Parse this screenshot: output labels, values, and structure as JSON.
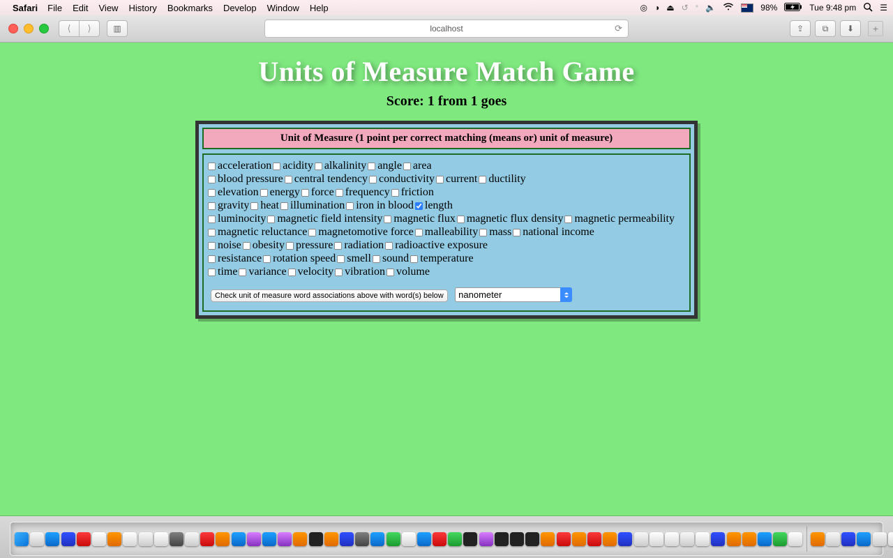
{
  "menubar": {
    "app": "Safari",
    "items": [
      "File",
      "Edit",
      "View",
      "History",
      "Bookmarks",
      "Develop",
      "Window",
      "Help"
    ],
    "battery": "98%",
    "clock": "Tue 9:48 pm"
  },
  "browser": {
    "url": "localhost"
  },
  "page": {
    "title": "Units of Measure Match Game",
    "score_label": "Score: 1 from 1 goes",
    "instruction": "Unit of Measure (1 point per correct matching (means or) unit of measure)",
    "checkboxes": [
      {
        "label": "acceleration",
        "checked": false
      },
      {
        "label": "acidity",
        "checked": false
      },
      {
        "label": "alkalinity",
        "checked": false
      },
      {
        "label": "angle",
        "checked": false
      },
      {
        "label": "area",
        "checked": false,
        "break": true
      },
      {
        "label": "blood pressure",
        "checked": false
      },
      {
        "label": "central tendency",
        "checked": false
      },
      {
        "label": "conductivity",
        "checked": false
      },
      {
        "label": "current",
        "checked": false
      },
      {
        "label": "ductility",
        "checked": false,
        "break": true
      },
      {
        "label": "elevation",
        "checked": false
      },
      {
        "label": "energy",
        "checked": false
      },
      {
        "label": "force",
        "checked": false
      },
      {
        "label": "frequency",
        "checked": false
      },
      {
        "label": "friction",
        "checked": false,
        "break": true
      },
      {
        "label": "gravity",
        "checked": false
      },
      {
        "label": "heat",
        "checked": false
      },
      {
        "label": "illumination",
        "checked": false
      },
      {
        "label": "iron in blood",
        "checked": false
      },
      {
        "label": "length",
        "checked": true,
        "break": true
      },
      {
        "label": "luminocity",
        "checked": false
      },
      {
        "label": "magnetic field intensity",
        "checked": false
      },
      {
        "label": "magnetic flux",
        "checked": false
      },
      {
        "label": "magnetic flux density",
        "checked": false
      },
      {
        "label": "magnetic permeability",
        "checked": false,
        "break": true
      },
      {
        "label": "magnetic reluctance",
        "checked": false
      },
      {
        "label": "magnetomotive force",
        "checked": false
      },
      {
        "label": "malleability",
        "checked": false
      },
      {
        "label": "mass",
        "checked": false
      },
      {
        "label": "national income",
        "checked": false,
        "break": true
      },
      {
        "label": "noise",
        "checked": false
      },
      {
        "label": "obesity",
        "checked": false
      },
      {
        "label": "pressure",
        "checked": false
      },
      {
        "label": "radiation",
        "checked": false
      },
      {
        "label": "radioactive exposure",
        "checked": false,
        "break": true
      },
      {
        "label": "resistance",
        "checked": false
      },
      {
        "label": "rotation speed",
        "checked": false
      },
      {
        "label": "smell",
        "checked": false
      },
      {
        "label": "sound",
        "checked": false
      },
      {
        "label": "temperature",
        "checked": false,
        "break": true
      },
      {
        "label": "time",
        "checked": false
      },
      {
        "label": "variance",
        "checked": false
      },
      {
        "label": "velocity",
        "checked": false
      },
      {
        "label": "vibration",
        "checked": false
      },
      {
        "label": "volume",
        "checked": false
      }
    ],
    "check_button": "Check unit of measure word associations above with word(s) below",
    "select_value": "nanometer"
  },
  "dock": {
    "icons": [
      "finder",
      "c1",
      "c2",
      "c3",
      "c4",
      "c9",
      "c5",
      "c9",
      "c1",
      "c9",
      "c6",
      "c1",
      "c4",
      "c5",
      "c2",
      "c7",
      "c2",
      "c7",
      "c5",
      "c10",
      "c5",
      "c3",
      "c6",
      "c2",
      "c8",
      "c9",
      "c2",
      "c4",
      "c8",
      "c10",
      "c7",
      "c10",
      "c10",
      "c10",
      "c5",
      "c4",
      "c5",
      "c4",
      "c5",
      "c3",
      "c1",
      "c9",
      "c9",
      "c1",
      "c9",
      "c3",
      "c5",
      "c5",
      "c2",
      "c8",
      "c9"
    ],
    "right_icons": [
      "c5",
      "c1",
      "c3",
      "c2",
      "c1",
      "c9",
      "c10",
      "c1"
    ]
  }
}
